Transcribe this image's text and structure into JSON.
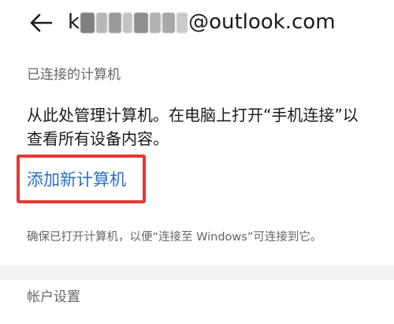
{
  "header": {
    "title_prefix": "k",
    "title_suffix": "@outlook.com",
    "redacted_colors": [
      "#7f7f7f",
      "#b8b8b8",
      "#9a9a9a",
      "#c4c4c4",
      "#8e8e8e",
      "#b2b2b2",
      "#a8a8a8",
      "#cacaca"
    ],
    "back_icon": "arrow-left-icon"
  },
  "connected_section": {
    "title": "已连接的计算机",
    "description": "从此处管理计算机。在电脑上打开“手机连接”以查看所有设备内容。",
    "add_link": "添加新计算机",
    "hint": "确保已打开计算机，以便“连接至 Windows”可连接到它。"
  },
  "account_section": {
    "title": "帐户设置"
  },
  "colors": {
    "link": "#2b6fc2",
    "highlight": "#e53935",
    "separator": "#f2f2f2",
    "secondary_text": "#666666"
  }
}
